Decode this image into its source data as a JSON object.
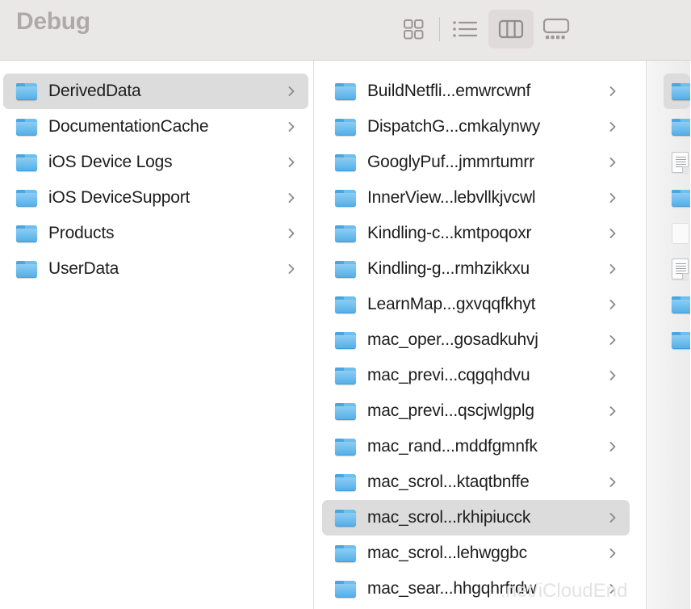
{
  "window": {
    "title": "Debug"
  },
  "toolbar": {
    "view_modes": [
      {
        "name": "icon-view",
        "icon": "grid-icon",
        "label": "Icon View",
        "selected": false
      },
      {
        "name": "list-view",
        "icon": "list-icon",
        "label": "List View",
        "selected": false
      },
      {
        "name": "column-view",
        "icon": "column-icon",
        "label": "Column View",
        "selected": true
      },
      {
        "name": "gallery-view",
        "icon": "gallery-icon",
        "label": "Gallery View",
        "selected": false
      }
    ]
  },
  "columns": [
    {
      "id": "column-1",
      "items": [
        {
          "label": "DerivedData",
          "icon": "folder-icon",
          "selected": true,
          "chevron": true
        },
        {
          "label": "DocumentationCache",
          "icon": "folder-icon",
          "selected": false,
          "chevron": true
        },
        {
          "label": "iOS Device Logs",
          "icon": "folder-icon",
          "selected": false,
          "chevron": true
        },
        {
          "label": "iOS DeviceSupport",
          "icon": "folder-icon",
          "selected": false,
          "chevron": true
        },
        {
          "label": "Products",
          "icon": "folder-icon",
          "selected": false,
          "chevron": true
        },
        {
          "label": "UserData",
          "icon": "folder-icon",
          "selected": false,
          "chevron": true
        }
      ]
    },
    {
      "id": "column-2",
      "items": [
        {
          "label": "BuildNetfli...emwrcwnf",
          "icon": "folder-icon",
          "selected": false,
          "chevron": true
        },
        {
          "label": "DispatchG...cmkalynwy",
          "icon": "folder-icon",
          "selected": false,
          "chevron": true
        },
        {
          "label": "GooglyPuf...jmmrtumrr",
          "icon": "folder-icon",
          "selected": false,
          "chevron": true
        },
        {
          "label": "InnerView...lebvllkjvcwl",
          "icon": "folder-icon",
          "selected": false,
          "chevron": true
        },
        {
          "label": "Kindling-c...kmtpoqoxr",
          "icon": "folder-icon",
          "selected": false,
          "chevron": true
        },
        {
          "label": "Kindling-g...rmhzikkxu",
          "icon": "folder-icon",
          "selected": false,
          "chevron": true
        },
        {
          "label": "LearnMap...gxvqqfkhyt",
          "icon": "folder-icon",
          "selected": false,
          "chevron": true
        },
        {
          "label": "mac_oper...gosadkuhvj",
          "icon": "folder-icon",
          "selected": false,
          "chevron": true
        },
        {
          "label": "mac_previ...cqgqhdvu",
          "icon": "folder-icon",
          "selected": false,
          "chevron": true
        },
        {
          "label": "mac_previ...qscjwlgplg",
          "icon": "folder-icon",
          "selected": false,
          "chevron": true
        },
        {
          "label": "mac_rand...mddfgmnfk",
          "icon": "folder-icon",
          "selected": false,
          "chevron": true
        },
        {
          "label": "mac_scrol...ktaqtbnffe",
          "icon": "folder-icon",
          "selected": false,
          "chevron": true
        },
        {
          "label": "mac_scrol...rkhipiucck",
          "icon": "folder-icon",
          "selected": true,
          "chevron": true
        },
        {
          "label": "mac_scrol...lehwggbc",
          "icon": "folder-icon",
          "selected": false,
          "chevron": true
        },
        {
          "label": "mac_sear...hhgqhrfrdw",
          "icon": "folder-icon",
          "selected": false,
          "chevron": true
        }
      ]
    },
    {
      "id": "column-3",
      "items": [
        {
          "label": "",
          "icon": "folder-icon",
          "selected": true,
          "chevron": false
        },
        {
          "label": "",
          "icon": "folder-icon",
          "selected": false,
          "chevron": false
        },
        {
          "label": "",
          "icon": "document-icon",
          "selected": false,
          "chevron": false
        },
        {
          "label": "",
          "icon": "folder-icon",
          "selected": false,
          "chevron": false
        },
        {
          "label": "",
          "icon": "blank-icon",
          "selected": false,
          "chevron": false
        },
        {
          "label": "",
          "icon": "document-icon",
          "selected": false,
          "chevron": false
        },
        {
          "label": "",
          "icon": "folder-icon",
          "selected": false,
          "chevron": false
        },
        {
          "label": "",
          "icon": "folder-icon",
          "selected": false,
          "chevron": false
        }
      ]
    }
  ],
  "watermark": {
    "text": ".net/iCloudEnd"
  },
  "colors": {
    "toolbar_bg": "#eae8e7",
    "title_text": "#aeaaa8",
    "selection_bg": "#dcdcdc",
    "folder_blue": "#6ebdee",
    "row_text": "#1d1d1d",
    "chevron": "#8a8a8a"
  }
}
